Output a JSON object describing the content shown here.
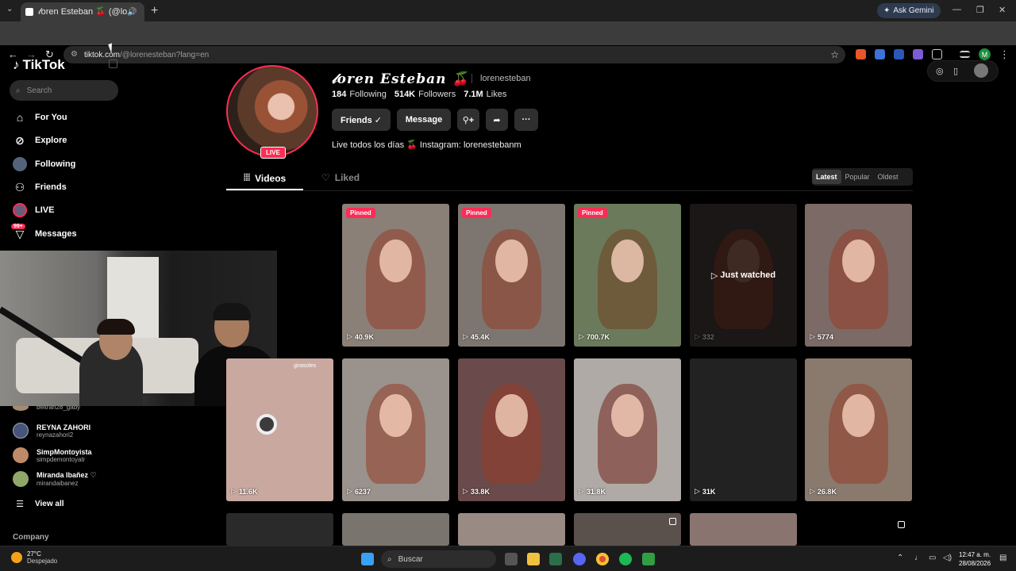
{
  "browser": {
    "tab_title": "𝓁oren Esteban 🍒 (@lo",
    "url_host": "tiktok.com",
    "url_path": "/@lorenesteban?lang=en",
    "gemini": "Ask Gemini",
    "avatar_letter": "M"
  },
  "sidebar": {
    "logo": "TikTok",
    "search_placeholder": "Search",
    "nav": [
      {
        "label": "For You",
        "icon": "home-icon"
      },
      {
        "label": "Explore",
        "icon": "compass-icon"
      },
      {
        "label": "Following",
        "icon": "following-avatar-icon"
      },
      {
        "label": "Friends",
        "icon": "friends-icon"
      },
      {
        "label": "LIVE",
        "icon": "live-icon"
      },
      {
        "label": "Messages",
        "icon": "messages-icon",
        "badge": "99+"
      }
    ],
    "following": [
      {
        "name": "",
        "user": "beltran28_gaby"
      },
      {
        "name": "REYNA ZAHORI",
        "user": "reynazahori2"
      },
      {
        "name": "SimpMontoyista",
        "user": "simpdemontoyatr"
      },
      {
        "name": "Miranda Ibañez ♡",
        "user": "mirandaibanez"
      }
    ],
    "view_all": "View all",
    "company": "Company"
  },
  "profile": {
    "display_name": "𝓁oren Esteban 🍒",
    "username": "lorenesteban",
    "following_count": "184",
    "following_label": "Following",
    "followers_count": "514K",
    "followers_label": "Followers",
    "likes_count": "7.1M",
    "likes_label": "Likes",
    "friends_btn": "Friends ✓",
    "message_btn": "Message",
    "bio": "Live todos los días 🍒 Instagram: lorenestebanm",
    "live_tag": "LIVE"
  },
  "tabs": {
    "videos": "Videos",
    "liked": "Liked"
  },
  "sort": {
    "latest": "Latest",
    "popular": "Popular",
    "oldest": "Oldest"
  },
  "videos": [
    {
      "views": "40.9K",
      "pinned": "Pinned",
      "bg": "#8a8078"
    },
    {
      "views": "45.4K",
      "pinned": "Pinned",
      "bg": "#7d7670"
    },
    {
      "views": "700.7K",
      "pinned": "Pinned",
      "bg": "#6b7a5a"
    },
    {
      "views": "332",
      "overlay": "Just watched",
      "bg": "#3a3432"
    },
    {
      "views": "5774",
      "bg": "#7c6a66"
    },
    {
      "views": "11.6K",
      "caption": "girasoles",
      "bg": "#c9a8a0"
    },
    {
      "views": "6237",
      "bg": "#9a928c"
    },
    {
      "views": "33.8K",
      "bg": "#6a4a4a"
    },
    {
      "views": "31.8K",
      "bg": "#b0aaa6"
    },
    {
      "views": "31K",
      "bg": "#222222"
    },
    {
      "views": "26.8K",
      "bg": "#8a7a6e"
    }
  ],
  "taskbar": {
    "temp": "27°C",
    "weather": "Despejado",
    "search": "Buscar",
    "time": "12:47 a. m.",
    "date": "28/08/2026"
  }
}
